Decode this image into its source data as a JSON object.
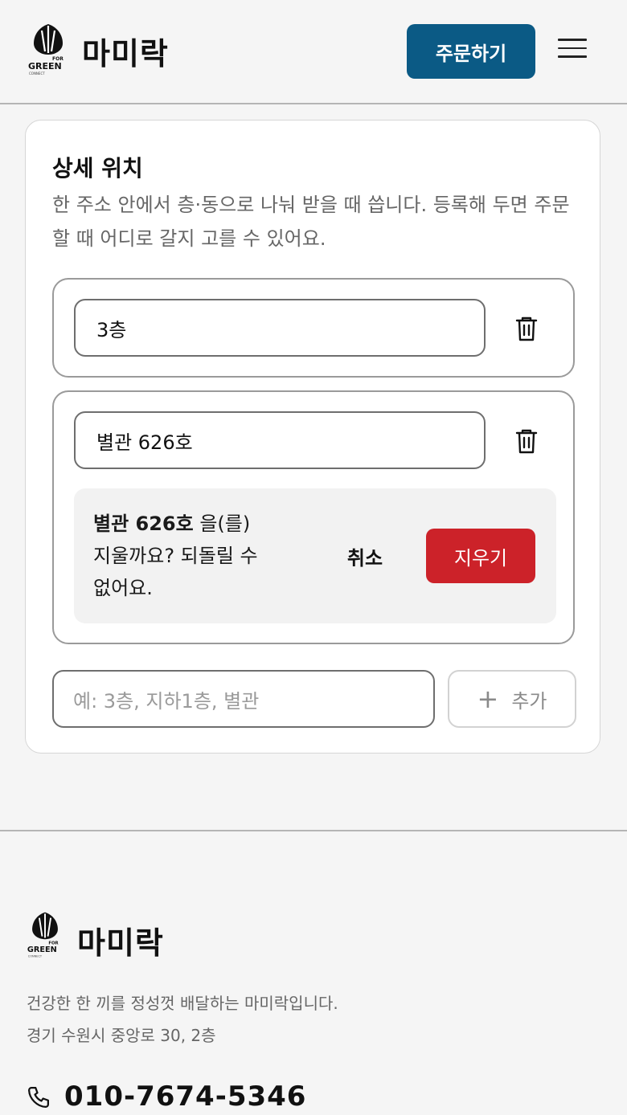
{
  "header": {
    "logo_text_top": "FOR",
    "logo_text_main": "GREEN",
    "logo_text_bottom": "CONNECT",
    "brand": "마미락",
    "order_button": "주문하기",
    "menu_icon": "hamburger-icon"
  },
  "section": {
    "title": "상세 위치",
    "description": "한 주소 안에서 층·동으로 나눠 받을 때 씁니다. 등록해 두면 주문할 때 어디로 갈지 고를 수 있어요.",
    "locations": [
      {
        "value": "3층",
        "delete_icon": "trash-icon"
      },
      {
        "value": "별관 626호",
        "delete_icon": "trash-icon"
      }
    ],
    "confirm": {
      "name": "별관 626호",
      "line1_suffix": " 을(를)",
      "rest": "지울까요? 되돌릴 수 없어요.",
      "cancel_label": "취소",
      "delete_label": "지우기",
      "delete_color": "#cc2229"
    },
    "new_location_placeholder": "예: 3층, 지하1층, 별관",
    "add_label": "추가"
  },
  "footer": {
    "brand": "마미락",
    "description_line1": "건강한 한 끼를 정성껏 배달하는 마미락입니다.",
    "description_line2": "경기 수원시 중앙로 30, 2층",
    "phone": "010-7674-5346",
    "phone_icon": "phone-icon"
  },
  "colors": {
    "primary": "#0b5a85",
    "danger": "#cc2229"
  }
}
